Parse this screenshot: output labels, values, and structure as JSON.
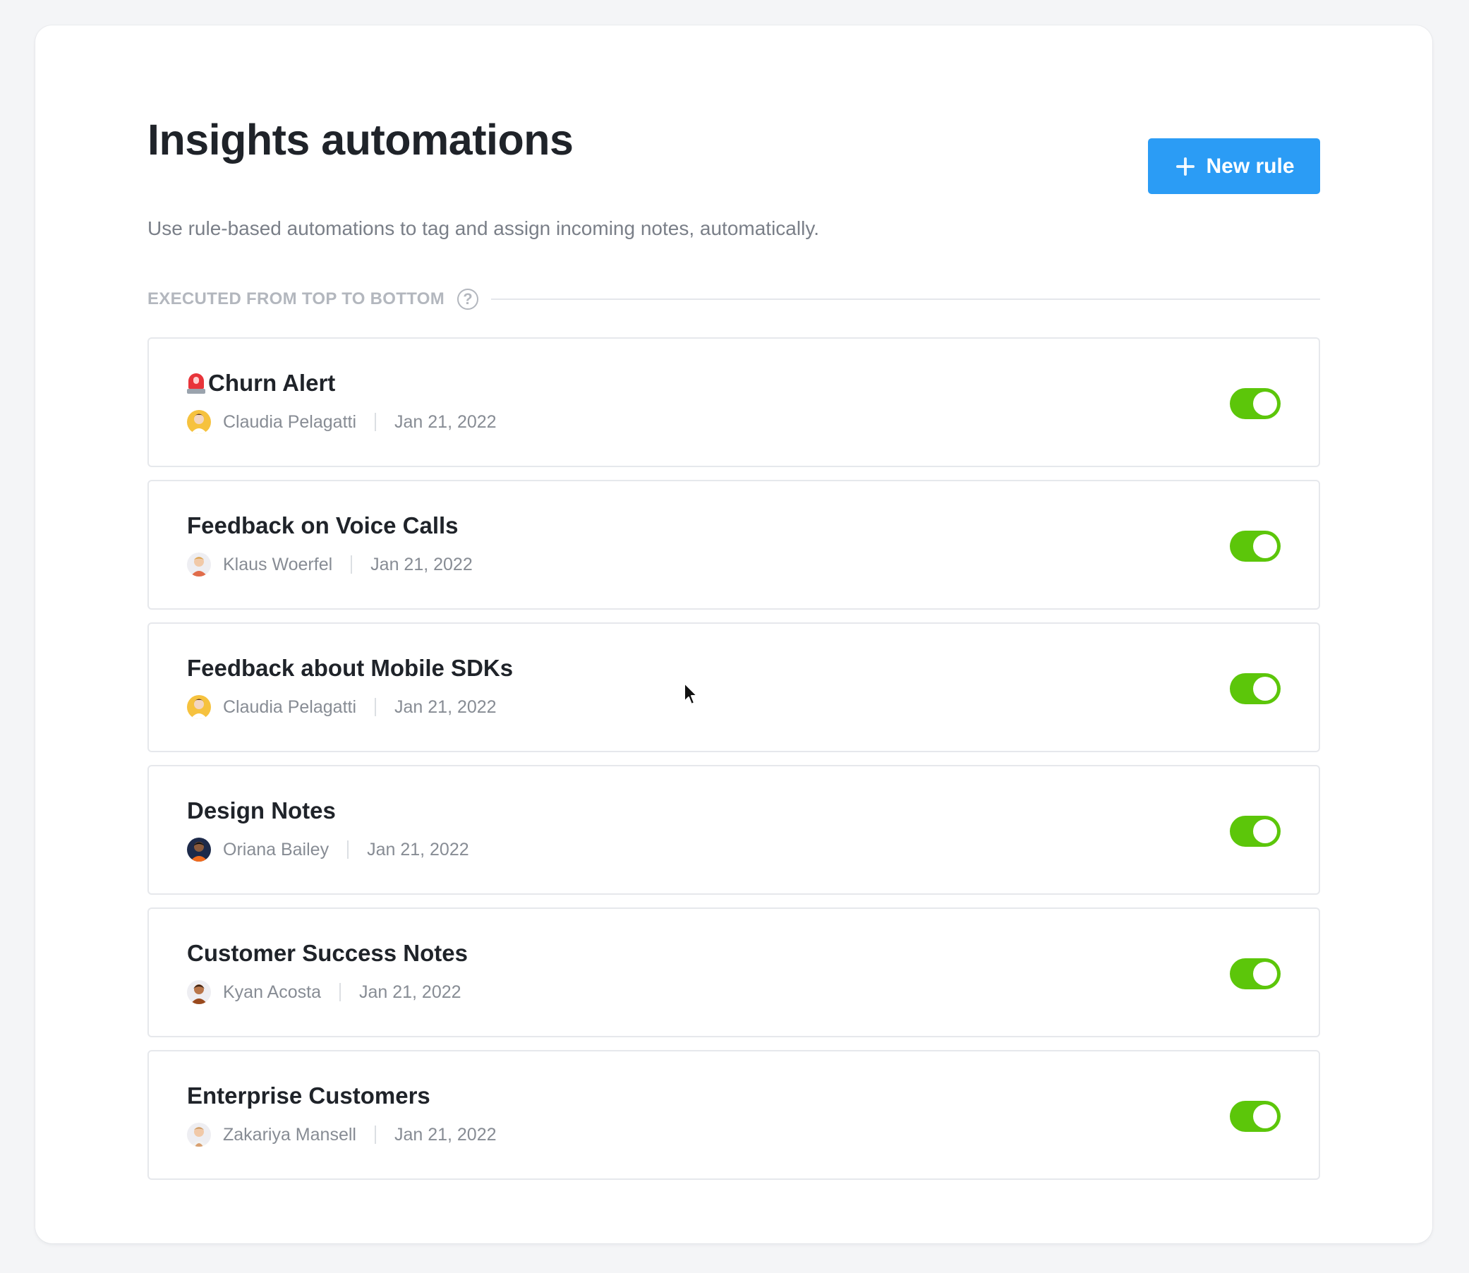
{
  "header": {
    "title": "Insights automations",
    "new_rule_label": "New rule"
  },
  "subtitle": "Use rule-based automations to tag and assign incoming notes, automatically.",
  "section": {
    "label": "EXECUTED FROM TOP TO BOTTOM",
    "help_glyph": "?"
  },
  "rules": [
    {
      "title": "Churn Alert",
      "title_icon": "rotating-light-icon",
      "author": "Claudia Pelagatti",
      "date": "Jan 21, 2022",
      "enabled": true
    },
    {
      "title": "Feedback on Voice Calls",
      "author": "Klaus Woerfel",
      "date": "Jan 21, 2022",
      "enabled": true
    },
    {
      "title": "Feedback about Mobile SDKs",
      "author": "Claudia Pelagatti",
      "date": "Jan 21, 2022",
      "enabled": true
    },
    {
      "title": "Design Notes",
      "author": "Oriana Bailey",
      "date": "Jan 21, 2022",
      "enabled": true
    },
    {
      "title": "Customer Success Notes",
      "author": "Kyan Acosta",
      "date": "Jan 21, 2022",
      "enabled": true
    },
    {
      "title": "Enterprise Customers",
      "author": "Zakariya Mansell",
      "date": "Jan 21, 2022",
      "enabled": true
    }
  ],
  "colors": {
    "primary_button": "#2b9cf5",
    "toggle_on": "#5cc60a",
    "muted_text": "#878c94",
    "section_label": "#b3b7be"
  }
}
